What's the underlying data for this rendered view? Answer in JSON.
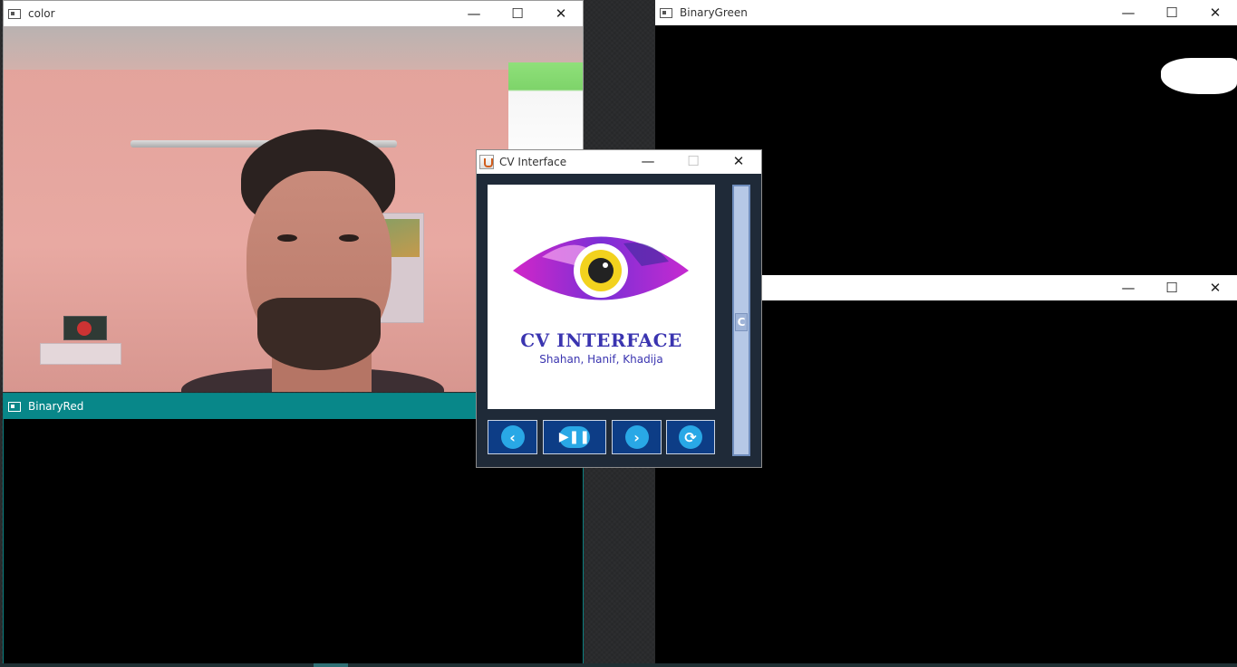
{
  "windows": {
    "color": {
      "title": "color"
    },
    "binary_red": {
      "title": "BinaryRed"
    },
    "binary_green": {
      "title": "BinaryGreen"
    },
    "binary_blue": {
      "title": ""
    },
    "cv_interface": {
      "title": "CV Interface",
      "logo_title": "CV INTERFACE",
      "logo_subtitle": "Shahan, Hanif, Khadija",
      "slider_thumb_label": "C",
      "buttons": {
        "previous": {
          "icon": "chevron-left-icon"
        },
        "play_pause": {
          "icon": "play-pause-icon"
        },
        "next": {
          "icon": "chevron-right-icon"
        },
        "refresh": {
          "icon": "refresh-icon"
        }
      }
    }
  },
  "window_controls": {
    "minimize": "—",
    "maximize": "☐",
    "close": "✕"
  },
  "colors": {
    "teal_titlebar": "#088789",
    "button_bg": "#0d3d86",
    "button_icon": "#29a8e6",
    "logo_text": "#3a34b0",
    "cv_bg": "#1f2a38"
  }
}
